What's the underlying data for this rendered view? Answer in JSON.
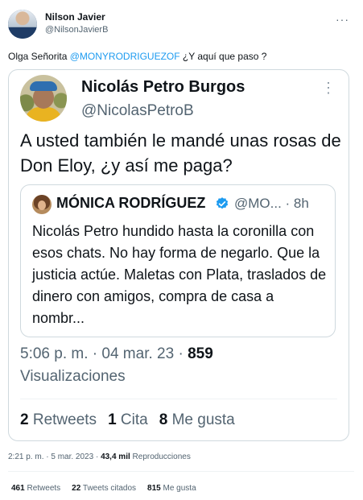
{
  "outer": {
    "author_name": "Nilson Javier",
    "author_handle": "@NilsonJavierB",
    "more": "···",
    "text_prefix": "Olga Señorita ",
    "mention": "@MONYRODRIGUEZOF",
    "text_suffix": " ¿Y aquí que paso ?",
    "time": "2:21 p. m.",
    "date": "5 mar. 2023",
    "views_count": "43,4 mil",
    "views_label": "Reproducciones",
    "retweets_count": "461",
    "retweets_label": "Retweets",
    "quotes_count": "22",
    "quotes_label": "Tweets citados",
    "likes_count": "815",
    "likes_label": "Me gusta"
  },
  "quoted": {
    "author_name": "Nicolás Petro Burgos",
    "author_handle": "@NicolasPetroB",
    "more": "⋮",
    "text": "A usted también le mandé unas rosas de Don Eloy, ¿y así me paga?",
    "time": "5:06 p. m.",
    "date": "04 mar. 23",
    "views_count": "859",
    "views_label": "Visualizaciones",
    "retweets_count": "2",
    "retweets_label": "Retweets",
    "quotes_count": "1",
    "quotes_label": "Cita",
    "likes_count": "8",
    "likes_label": "Me gusta"
  },
  "nested": {
    "author_name": "MÓNICA RODRÍGUEZ",
    "author_handle": "@MO... · 8h",
    "text": "Nicolás Petro hundido hasta la coronilla con esos chats. No hay  forma de negarlo. Que la justicia actúe. Maletas con Plata, traslados de dinero con amigos, compra de casa a nombr...",
    "verified_icon": "verified-badge-icon",
    "verified_color": "#1d9bf0"
  }
}
